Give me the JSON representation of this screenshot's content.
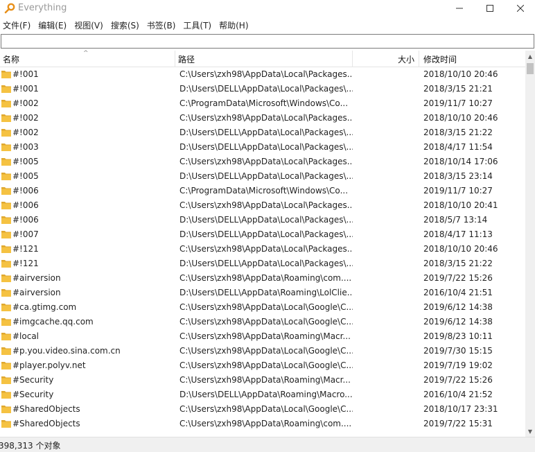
{
  "window": {
    "title": "Everything",
    "minimize": "—",
    "maximize": "☐",
    "close": "✕"
  },
  "menu": [
    "文件(F)",
    "编辑(E)",
    "视图(V)",
    "搜索(S)",
    "书签(B)",
    "工具(T)",
    "帮助(H)"
  ],
  "search": {
    "value": "",
    "placeholder": ""
  },
  "columns": {
    "name": "名称",
    "path": "路径",
    "size": "大小",
    "date": "修改时间",
    "sort_indicator": "^"
  },
  "rows": [
    {
      "name": "#!001",
      "path": "C:\\Users\\zxh98\\AppData\\Local\\Packages...",
      "date": "2018/10/10 20:46"
    },
    {
      "name": "#!001",
      "path": "D:\\Users\\DELL\\AppData\\Local\\Packages\\...",
      "date": "2018/3/15 21:21"
    },
    {
      "name": "#!002",
      "path": "C:\\ProgramData\\Microsoft\\Windows\\Co...",
      "date": "2019/11/7 10:27"
    },
    {
      "name": "#!002",
      "path": "C:\\Users\\zxh98\\AppData\\Local\\Packages...",
      "date": "2018/10/10 20:46"
    },
    {
      "name": "#!002",
      "path": "D:\\Users\\DELL\\AppData\\Local\\Packages\\...",
      "date": "2018/3/15 21:22"
    },
    {
      "name": "#!003",
      "path": "D:\\Users\\DELL\\AppData\\Local\\Packages\\...",
      "date": "2018/4/17 11:54"
    },
    {
      "name": "#!005",
      "path": "C:\\Users\\zxh98\\AppData\\Local\\Packages...",
      "date": "2018/10/14 17:06"
    },
    {
      "name": "#!005",
      "path": "D:\\Users\\DELL\\AppData\\Local\\Packages\\...",
      "date": "2018/3/15 23:14"
    },
    {
      "name": "#!006",
      "path": "C:\\ProgramData\\Microsoft\\Windows\\Co...",
      "date": "2019/11/7 10:27"
    },
    {
      "name": "#!006",
      "path": "C:\\Users\\zxh98\\AppData\\Local\\Packages...",
      "date": "2018/10/10 20:41"
    },
    {
      "name": "#!006",
      "path": "D:\\Users\\DELL\\AppData\\Local\\Packages\\...",
      "date": "2018/5/7 13:14"
    },
    {
      "name": "#!007",
      "path": "D:\\Users\\DELL\\AppData\\Local\\Packages\\...",
      "date": "2018/4/17 11:13"
    },
    {
      "name": "#!121",
      "path": "C:\\Users\\zxh98\\AppData\\Local\\Packages...",
      "date": "2018/10/10 20:46"
    },
    {
      "name": "#!121",
      "path": "D:\\Users\\DELL\\AppData\\Local\\Packages\\...",
      "date": "2018/3/15 21:22"
    },
    {
      "name": "#airversion",
      "path": "C:\\Users\\zxh98\\AppData\\Roaming\\com....",
      "date": "2019/7/22 15:26"
    },
    {
      "name": "#airversion",
      "path": "D:\\Users\\DELL\\AppData\\Roaming\\LolClie...",
      "date": "2016/10/4 21:51"
    },
    {
      "name": "#ca.gtimg.com",
      "path": "C:\\Users\\zxh98\\AppData\\Local\\Google\\C...",
      "date": "2019/6/12 14:38"
    },
    {
      "name": "#imgcache.qq.com",
      "path": "C:\\Users\\zxh98\\AppData\\Local\\Google\\C...",
      "date": "2019/6/12 14:38"
    },
    {
      "name": "#local",
      "path": "C:\\Users\\zxh98\\AppData\\Roaming\\Macr...",
      "date": "2019/8/23 10:11"
    },
    {
      "name": "#p.you.video.sina.com.cn",
      "path": "C:\\Users\\zxh98\\AppData\\Local\\Google\\C...",
      "date": "2019/7/30 15:15"
    },
    {
      "name": "#player.polyv.net",
      "path": "C:\\Users\\zxh98\\AppData\\Local\\Google\\C...",
      "date": "2019/7/19 19:02"
    },
    {
      "name": "#Security",
      "path": "C:\\Users\\zxh98\\AppData\\Roaming\\Macr...",
      "date": "2019/7/22 15:26"
    },
    {
      "name": "#Security",
      "path": "D:\\Users\\DELL\\AppData\\Roaming\\Macro...",
      "date": "2016/10/4 21:52"
    },
    {
      "name": "#SharedObjects",
      "path": "C:\\Users\\zxh98\\AppData\\Local\\Google\\C...",
      "date": "2018/10/17 23:31"
    },
    {
      "name": "#SharedObjects",
      "path": "C:\\Users\\zxh98\\AppData\\Roaming\\com....",
      "date": "2019/7/22 15:31"
    }
  ],
  "status": {
    "count_text": "398,313 个对象"
  },
  "colors": {
    "folder": "#f5c242",
    "folder_dark": "#e0a82e",
    "app_icon": "#e8901a"
  }
}
